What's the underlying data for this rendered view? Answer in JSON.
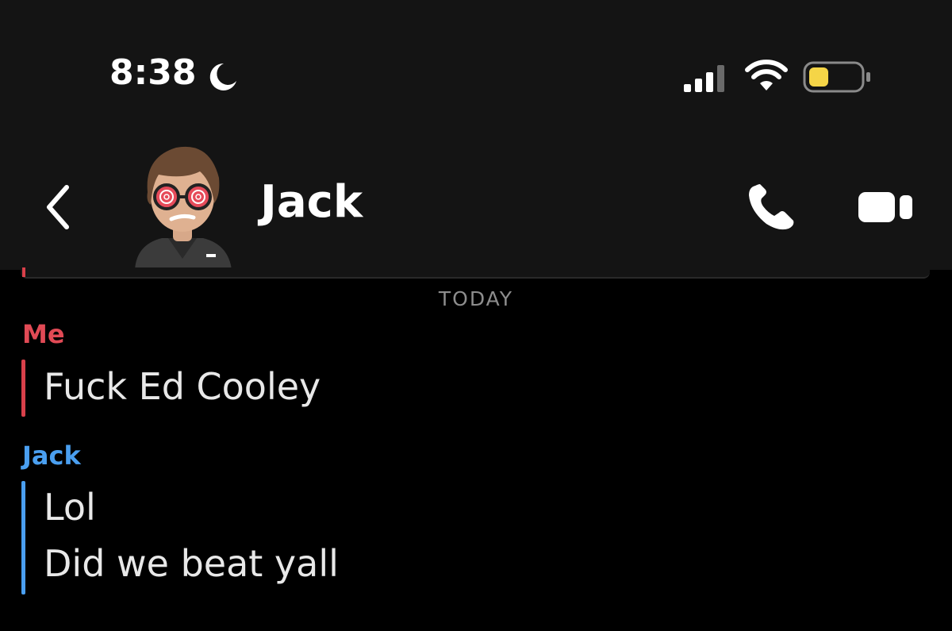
{
  "status_bar": {
    "time": "8:38",
    "focus_icon": "moon-icon",
    "signal_icon": "cellular-signal-icon",
    "wifi_icon": "wifi-icon",
    "battery_icon": "battery-icon",
    "battery_color": "#f5d547"
  },
  "header": {
    "back_icon": "chevron-left-icon",
    "contact_name": "Jack",
    "avatar_icon": "bitmoji-avatar",
    "call_icon": "phone-icon",
    "video_icon": "video-camera-icon"
  },
  "chat": {
    "date_divider": "TODAY",
    "messages": [
      {
        "sender": "Me",
        "sender_color": "#e14a55",
        "lines": [
          "Fuck Ed Cooley"
        ]
      },
      {
        "sender": "Jack",
        "sender_color": "#4a9ff0",
        "lines": [
          "Lol",
          "Did we beat yall"
        ]
      }
    ]
  }
}
